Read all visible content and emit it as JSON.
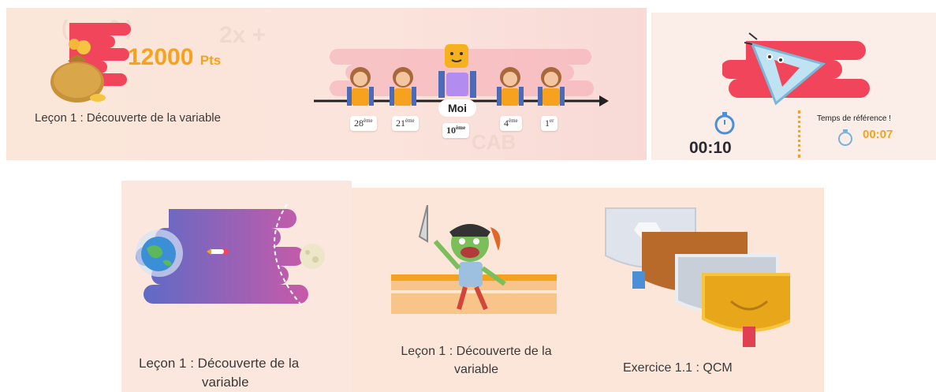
{
  "header": {
    "points_value": "12000",
    "points_unit": "Pts",
    "lesson_title": "Leçon 1 : Découverte de la variable"
  },
  "ranking": {
    "me_label": "Moi",
    "ranks": [
      {
        "num": "28",
        "suffix": "ème"
      },
      {
        "num": "21",
        "suffix": "ème"
      },
      {
        "num": "10",
        "suffix": "ème"
      },
      {
        "num": "4",
        "suffix": "ème"
      },
      {
        "num": "1",
        "suffix": "er"
      }
    ]
  },
  "timing": {
    "elapsed": "00:10",
    "reference_label": "Temps de référence !",
    "reference_time": "00:07"
  },
  "cards": [
    {
      "title_line1": "Leçon 1 : Découverte de la",
      "title_line2": "variable"
    },
    {
      "title_line1": "Leçon 1 : Découverte de la",
      "title_line2": "variable"
    },
    {
      "title": "Exercice 1.1 : QCM"
    }
  ],
  "colors": {
    "accent_orange": "#f6a21e",
    "accent_red": "#f0455a",
    "purple_start": "#5a6bc8",
    "purple_end": "#c85aa8"
  },
  "icons": [
    "money-bag-icon",
    "stopwatch-icon",
    "set-square-mascot-icon",
    "rocket-icon",
    "planet-earth-icon",
    "moon-icon",
    "pirate-goblin-icon",
    "medal-badge-icon"
  ]
}
